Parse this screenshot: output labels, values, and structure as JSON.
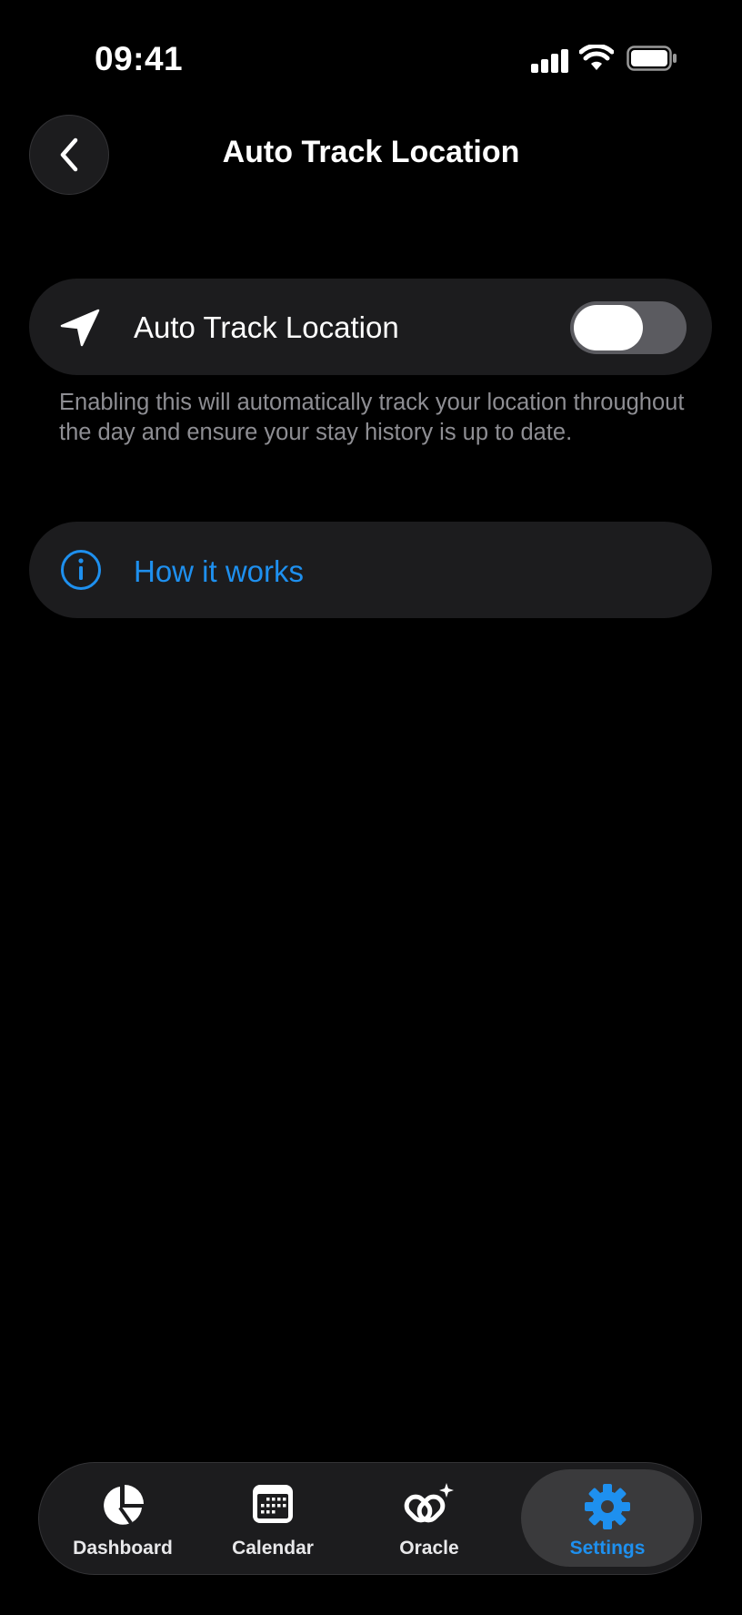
{
  "status_bar": {
    "time": "09:41"
  },
  "header": {
    "title": "Auto Track Location"
  },
  "toggle_card": {
    "label": "Auto Track Location",
    "enabled": false
  },
  "description": "Enabling this will automatically track your location throughout the day and ensure your stay history is up to date.",
  "how_it_works": {
    "label": "How it works"
  },
  "tab_bar": {
    "tabs": [
      {
        "label": "Dashboard",
        "icon": "pie-chart-icon"
      },
      {
        "label": "Calendar",
        "icon": "calendar-icon"
      },
      {
        "label": "Oracle",
        "icon": "oracle-icon"
      },
      {
        "label": "Settings",
        "icon": "gear-icon",
        "active": true
      }
    ]
  },
  "colors": {
    "accent": "#1e90ef",
    "card": "#1c1c1e",
    "background": "#000000"
  }
}
